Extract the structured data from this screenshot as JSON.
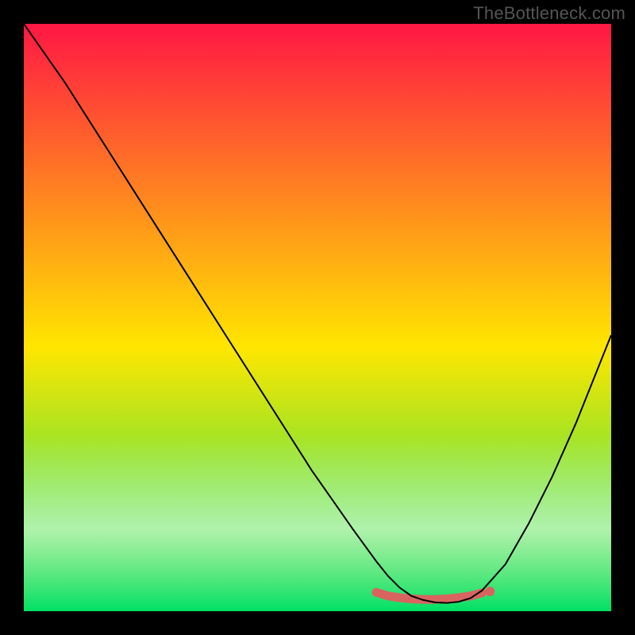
{
  "watermark": "TheBottleneck.com",
  "chart_data": {
    "type": "line",
    "title": "",
    "xlabel": "",
    "ylabel": "",
    "xlim": [
      0,
      100
    ],
    "ylim": [
      0,
      100
    ],
    "grid": false,
    "legend": false,
    "background_gradient": {
      "top_color": "#ff1744",
      "mid_color": "#ffe600",
      "bottom_color": "#00e065",
      "white_band_top_fraction": 0.82
    },
    "series": [
      {
        "name": "bottleneck-curve",
        "color": "#000000",
        "x": [
          0.0,
          7.0,
          14.0,
          21.0,
          28.0,
          35.0,
          42.0,
          49.0,
          56.0,
          60.0,
          62.0,
          64.0,
          66.0,
          68.0,
          70.0,
          72.0,
          74.0,
          76.0,
          78.0,
          82.0,
          86.0,
          90.0,
          94.0,
          98.0,
          100.0
        ],
        "y": [
          100.0,
          90.0,
          79.0,
          68.0,
          57.0,
          46.0,
          35.0,
          24.0,
          14.0,
          8.5,
          6.0,
          4.0,
          2.6,
          1.9,
          1.5,
          1.4,
          1.6,
          2.2,
          3.5,
          8.0,
          15.0,
          23.0,
          32.0,
          42.0,
          47.0
        ]
      },
      {
        "name": "region-marker",
        "color": "#d9645f",
        "type": "scatter",
        "x": [
          60.0,
          62.0,
          64.0,
          66.0,
          68.0,
          70.0,
          72.0,
          74.0,
          76.0,
          78.0
        ],
        "y": [
          3.2,
          2.6,
          2.3,
          2.1,
          2.0,
          2.0,
          2.1,
          2.3,
          2.6,
          3.1
        ]
      }
    ]
  }
}
